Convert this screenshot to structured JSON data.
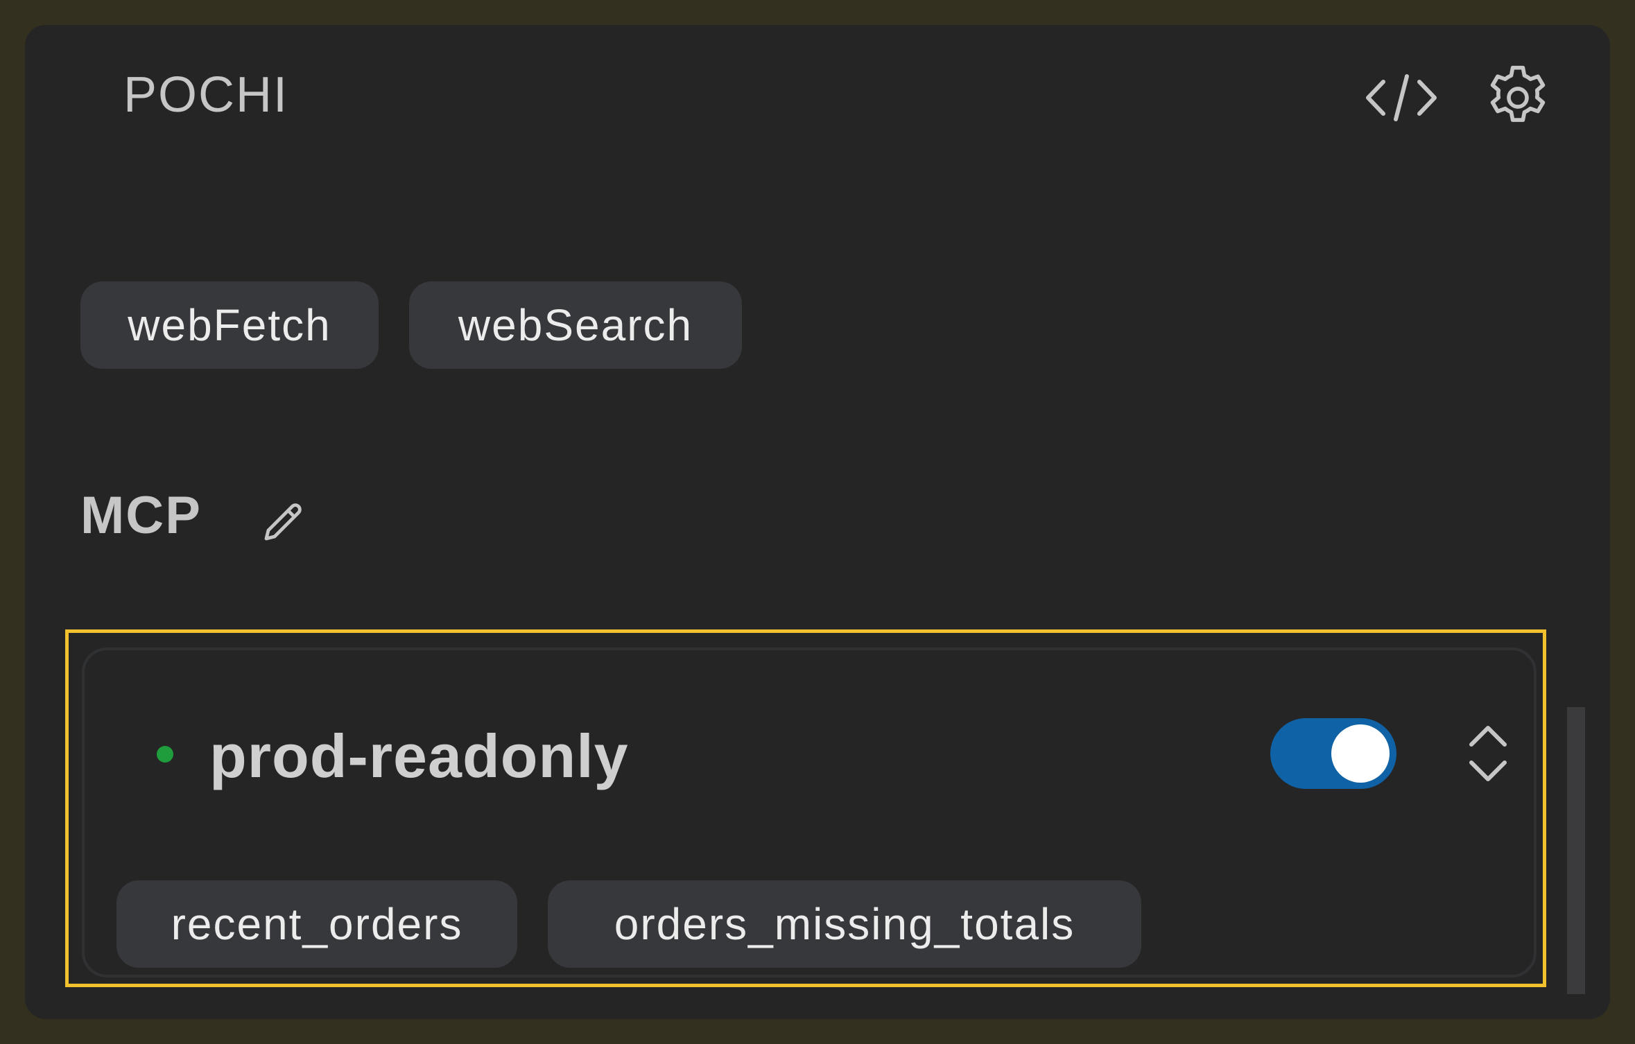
{
  "header": {
    "title": "POCHI",
    "code_icon": "code-icon",
    "settings_icon": "gear-icon"
  },
  "builtin_tools": [
    "webFetch",
    "webSearch"
  ],
  "mcp": {
    "label": "MCP",
    "edit_icon": "pencil-icon",
    "server": {
      "name": "prod-readonly",
      "status_color": "#1f9d3c",
      "enabled": true,
      "expand_icon": "chevron-up-down-icon",
      "tools": [
        "recent_orders",
        "orders_missing_totals"
      ]
    }
  },
  "colors": {
    "background": "#252526",
    "toggle_on": "#0f62a6",
    "highlight": "#f2c12e"
  }
}
